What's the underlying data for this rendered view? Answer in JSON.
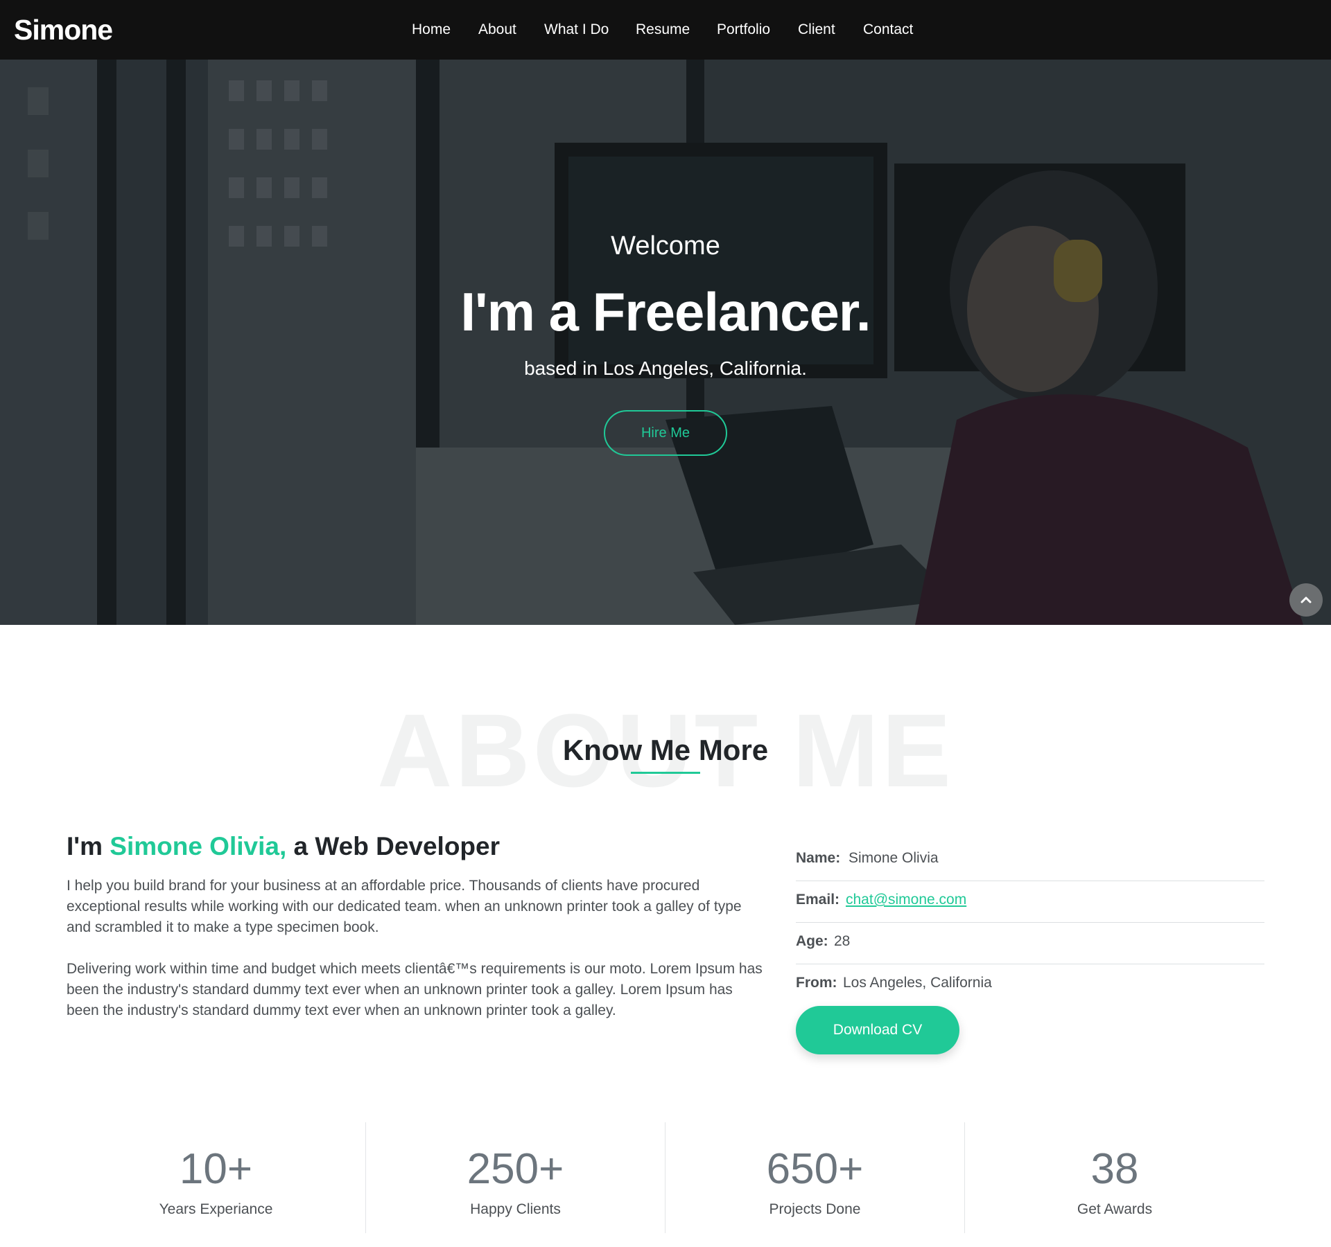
{
  "brand": "Simone",
  "nav": [
    "Home",
    "About",
    "What I Do",
    "Resume",
    "Portfolio",
    "Client",
    "Contact"
  ],
  "hero": {
    "welcome": "Welcome",
    "title": "I'm a Freelancer.",
    "subtitle": "based in Los Angeles, California.",
    "cta": "Hire Me"
  },
  "about": {
    "bg_title": "ABOUT ME",
    "title": "Know Me More",
    "heading_prefix": "I'm ",
    "heading_name": "Simone Olivia,",
    "heading_suffix": " a Web Developer",
    "para1": "I help you build brand for your business at an affordable price. Thousands of clients have procured exceptional results while working with our dedicated team. when an unknown printer took a galley of type and scrambled it to make a type specimen book.",
    "para2": "Delivering work within time and budget which meets clientâ€™s requirements is our moto. Lorem Ipsum has been the industry's standard dummy text ever when an unknown printer took a galley. Lorem Ipsum has been the industry's standard dummy text ever when an unknown printer took a galley.",
    "info": [
      {
        "label": "Name:",
        "value": "Simone Olivia"
      },
      {
        "label": "Email:",
        "value": "chat@simone.com"
      },
      {
        "label": "Age:",
        "value": "28"
      },
      {
        "label": "From:",
        "value": "Los Angeles, California"
      }
    ],
    "download": "Download CV"
  },
  "stats": [
    {
      "value": "10+",
      "label": "Years Experiance"
    },
    {
      "value": "250+",
      "label": "Happy Clients"
    },
    {
      "value": "650+",
      "label": "Projects Done"
    },
    {
      "value": "38",
      "label": "Get Awards"
    }
  ],
  "colors": {
    "accent": "#20c997",
    "nav_bg": "#111111"
  },
  "icons": {
    "scroll_top": "chevron-up-icon"
  }
}
